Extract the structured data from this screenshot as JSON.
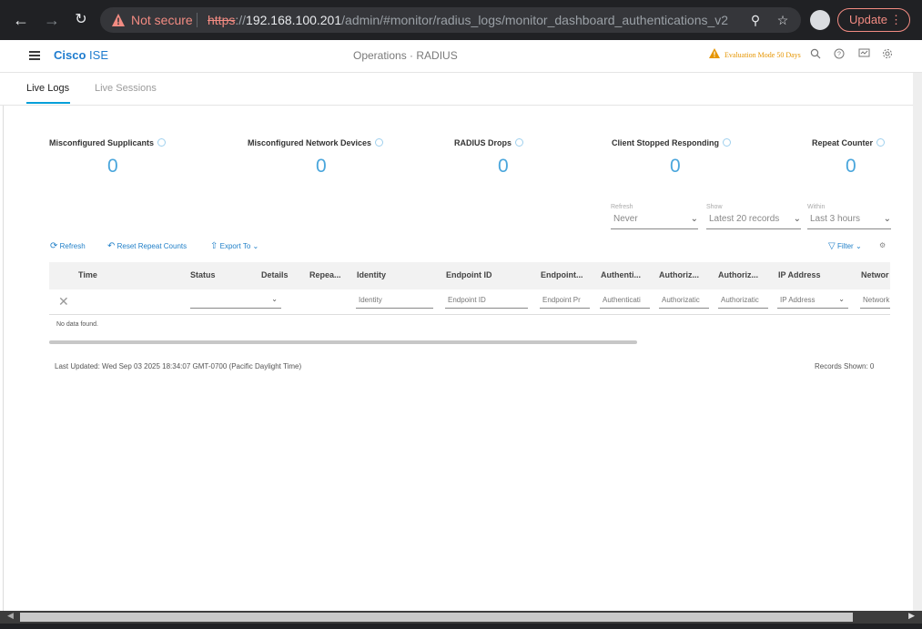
{
  "browser": {
    "security_label": "Not secure",
    "url_proto": "https",
    "url_sep": "://",
    "url_host": "192.168.100.201",
    "url_path": "/admin/#monitor/radius_logs/monitor_dashboard_authentications_v2",
    "update_label": "Update"
  },
  "header": {
    "brand_bold": "Cisco",
    "brand_light": "ISE",
    "title": "Operations · RADIUS",
    "eval_text": "Evaluation Mode 50 Days"
  },
  "tabs": [
    {
      "label": "Live Logs"
    },
    {
      "label": "Live Sessions"
    }
  ],
  "metrics": [
    {
      "label": "Misconfigured Supplicants",
      "value": "0"
    },
    {
      "label": "Misconfigured Network Devices",
      "value": "0"
    },
    {
      "label": "RADIUS Drops",
      "value": "0"
    },
    {
      "label": "Client Stopped Responding",
      "value": "0"
    },
    {
      "label": "Repeat Counter",
      "value": "0"
    }
  ],
  "filters": {
    "refresh": {
      "label": "Refresh",
      "value": "Never"
    },
    "show": {
      "label": "Show",
      "value": "Latest 20 records"
    },
    "within": {
      "label": "Within",
      "value": "Last 3 hours"
    }
  },
  "toolbar": {
    "refresh": "Refresh",
    "reset": "Reset Repeat Counts",
    "export": "Export To",
    "filter": "Filter"
  },
  "table": {
    "columns": [
      "Time",
      "Status",
      "Details",
      "Repea...",
      "Identity",
      "Endpoint ID",
      "Endpoint...",
      "Authenti...",
      "Authoriz...",
      "Authoriz...",
      "IP Address",
      "Networ"
    ],
    "filter_placeholders": [
      "Identity",
      "Endpoint ID",
      "Endpoint Pr",
      "Authenticati",
      "Authorizatic",
      "Authorizatic",
      "IP Address",
      "Network"
    ],
    "empty_text": "No data found."
  },
  "footer": {
    "last_updated": "Last Updated: Wed Sep 03 2025 18:34:07 GMT-0700 (Pacific Daylight Time)",
    "records_shown": "Records Shown: 0"
  },
  "colors": {
    "accent": "#049fd9",
    "metric_value": "#4aa6dc",
    "warning": "#e69500",
    "link": "#1f7fc8"
  }
}
